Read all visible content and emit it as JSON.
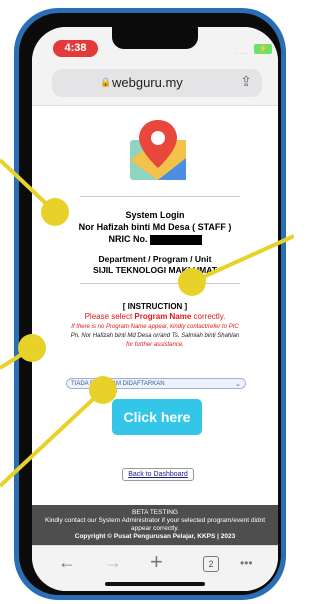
{
  "status_bar": {
    "time": "4:38",
    "signal": "....",
    "battery_symbol": "⚡"
  },
  "browser": {
    "url": "webguru.my",
    "lock_symbol": "🔒",
    "share_symbol": "⇪",
    "toolbar": {
      "back": "←",
      "forward": "→",
      "new_tab": "+",
      "tab_count": "2",
      "more": "•••"
    }
  },
  "page": {
    "title": "System Login",
    "user_line": "Nor Hafizah binti Md Desa ( STAFF )",
    "nric_label": "NRIC No.",
    "department_label": "Department / Program / Unit",
    "department_value": "SIJIL TEKNOLOGI MAKLUMAT",
    "instruction_heading": "[ INSTRUCTION ]",
    "select_prompt_pre": "Please select ",
    "select_prompt_bold": "Program Name",
    "select_prompt_post": " correctly.",
    "note_line1": "If there is no Program Name appear, kindly contact/refer to PIC",
    "note_line2": "Pn. Nor Hafizah binti Md Desa or/and Ts. Salmiah binti Shahlan",
    "note_line3": "for further assistance.",
    "program_select_value": "TIADA PROGRAM DIDAFTARKAN",
    "click_here_label": "Click here",
    "back_to_dashboard_label": "Back to Dashboard"
  },
  "footer": {
    "beta_label": "BETA TESTING",
    "beta_note_line1": "Kindly contact our System Administrator if your selected program/event didnt",
    "beta_note_line2": "appear correctly.",
    "copyright": "Copyright © Pusat Pengurusan Pelajar, KKPS | 2023"
  },
  "colors": {
    "phone_frame": "#2a6fb5",
    "time_pill": "#e23a3a",
    "click_button": "#33c6e8",
    "instruction_red": "#e01818",
    "annotation_yellow": "#e8d22a",
    "footer_bg": "#4e4e4e"
  },
  "icons": {
    "logo": "map-pin-icon"
  }
}
